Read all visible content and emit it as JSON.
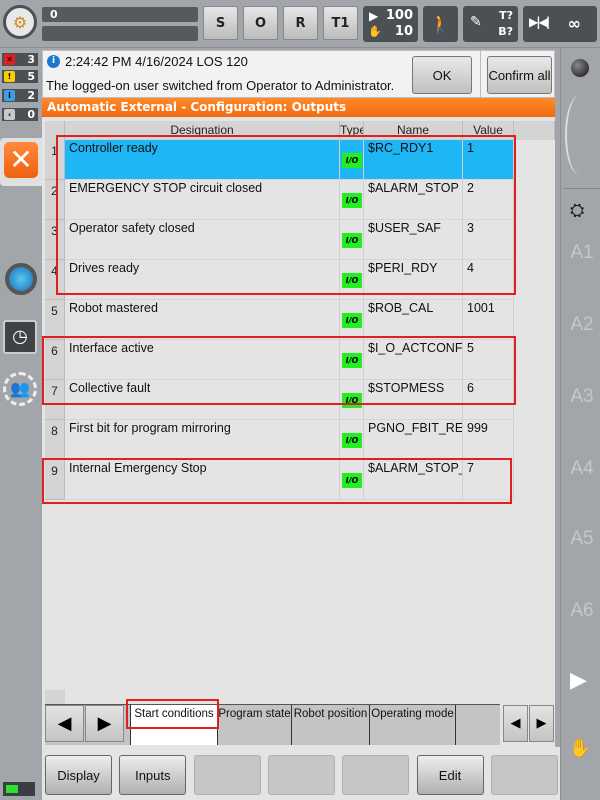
{
  "topbar": {
    "progress_top_value": "0",
    "progress_bottom_value": "",
    "buttons": [
      "S",
      "O",
      "R",
      "T1"
    ],
    "override_program": "100",
    "override_jog": "10",
    "tool_label": "T?",
    "base_label": "B?",
    "increment": "∞"
  },
  "message_counts": [
    {
      "type": "error",
      "count": "3",
      "color": "#e02020"
    },
    {
      "type": "warning",
      "count": "5",
      "color": "#f8d000"
    },
    {
      "type": "info",
      "count": "2",
      "color": "#3aa0e8"
    },
    {
      "type": "dialog",
      "count": "0",
      "color": "#c8c8c8"
    }
  ],
  "message": {
    "timestamp": "2:24:42 PM 4/16/2024 LOS 120",
    "text": "The logged-on user switched from Operator to Administrator.",
    "ok_label": "OK",
    "confirm_all_label": "Confirm all"
  },
  "title": "Automatic External - Configuration: Outputs",
  "table": {
    "columns": [
      "Designation",
      "Type",
      "Name",
      "Value"
    ],
    "type_badge": "I/O",
    "rows": [
      {
        "index": "1",
        "designation": "Controller ready",
        "name": "$RC_RDY1",
        "value": "1",
        "selected": true
      },
      {
        "index": "2",
        "designation": "EMERGENCY STOP circuit closed",
        "name": "$ALARM_STOP",
        "value": "2"
      },
      {
        "index": "3",
        "designation": "Operator safety closed",
        "name": "$USER_SAF",
        "value": "3"
      },
      {
        "index": "4",
        "designation": "Drives ready",
        "name": "$PERI_RDY",
        "value": "4"
      },
      {
        "index": "5",
        "designation": "Robot mastered",
        "name": "$ROB_CAL",
        "value": "1001"
      },
      {
        "index": "6",
        "designation": "Interface active",
        "name": "$I_O_ACTCONF",
        "value": "5"
      },
      {
        "index": "7",
        "designation": "Collective fault",
        "name": "$STOPMESS",
        "value": "6"
      },
      {
        "index": "8",
        "designation": "First bit for program mirroring",
        "name": "PGNO_FBIT_REFL",
        "value": "999"
      },
      {
        "index": "9",
        "designation": "Internal Emergency Stop",
        "name": "$ALARM_STOP_I",
        "value": "7"
      }
    ]
  },
  "tabs": [
    {
      "label": "Start conditions",
      "active": true
    },
    {
      "label": "Program state"
    },
    {
      "label": "Robot position"
    },
    {
      "label": "Operating mode"
    }
  ],
  "softkeys": [
    {
      "label": "Display",
      "enabled": true
    },
    {
      "label": "Inputs",
      "enabled": true
    },
    {
      "label": "",
      "enabled": false
    },
    {
      "label": "",
      "enabled": false
    },
    {
      "label": "",
      "enabled": false
    },
    {
      "label": "Edit",
      "enabled": true
    },
    {
      "label": "",
      "enabled": false
    }
  ],
  "axes": [
    "A1",
    "A2",
    "A3",
    "A4",
    "A5",
    "A6"
  ]
}
